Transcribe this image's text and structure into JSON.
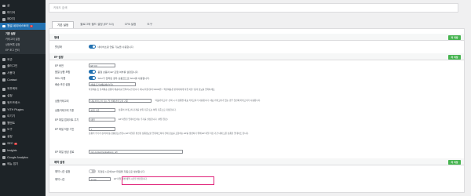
{
  "sidebar": {
    "items": [
      {
        "label": "글",
        "icon": "pin-icon"
      },
      {
        "label": "미디어",
        "icon": "media-icon"
      },
      {
        "label": "페이지",
        "icon": "page-icon"
      },
      {
        "label": "웹셀 네이버스토어",
        "icon": "store-icon",
        "badge": "1"
      }
    ],
    "submenu": [
      "기본 설정",
      "카테고리 설정",
      "상품목록 설정",
      "EP 포그 관리"
    ],
    "items2": [
      {
        "label": "외관",
        "icon": "brush-icon"
      },
      {
        "label": "플러그인",
        "icon": "plugin-icon"
      },
      {
        "label": "사용자",
        "icon": "user-icon"
      },
      {
        "label": "Contact",
        "icon": "mail-icon"
      },
      {
        "label": "외부케어",
        "icon": "tool-icon"
      },
      {
        "label": "설정",
        "icon": "gear-icon"
      },
      {
        "label": "워드프레스",
        "icon": "wp-icon"
      },
      {
        "label": "YITH Plugins",
        "icon": "yith-icon"
      },
      {
        "label": "이기기",
        "icon": "star-icon"
      },
      {
        "label": "웹앤트",
        "icon": "web-icon"
      },
      {
        "label": "도구",
        "icon": "wrench-icon"
      },
      {
        "label": "설정",
        "icon": "settings-icon"
      },
      {
        "label": "SEO",
        "icon": "seo-icon",
        "badge": "2"
      },
      {
        "label": "Insights",
        "icon": "insights-icon"
      },
      {
        "label": "Google Analytics",
        "icon": "analytics-icon"
      },
      {
        "label": "메뉴 접기",
        "icon": "collapse-icon"
      }
    ]
  },
  "topbar": {
    "placeholder": "키워드 검색"
  },
  "tabs": [
    "기본 설정",
    "블로그와 필드 설정 (EP 3.0)",
    "CPA 설정",
    "도구"
  ],
  "section1": {
    "title": "형태",
    "save": "저 저장",
    "rows": [
      {
        "label": "활성화",
        "text": "네이버쇼핑 연동 기능을 사용합니다."
      }
    ]
  },
  "section2": {
    "title": "EP 설정",
    "save": "저 저장",
    "rows": [
      {
        "label": "EP 버전",
        "field": "EP 3.0"
      },
      {
        "label": "품절 상품 포함",
        "text": "품절 상품의 EP 포함 여부를 설정합니다."
      },
      {
        "label": "SKU 사용",
        "text": "SKU가 입력된 경우 상품코드로 SKU를 사용합니다."
      },
      {
        "label": "배송 조건 설정",
        "field": "{배송조건}{배송비}{부가}",
        "note": "착불배송 및 설치배송 상품의 배송비를 입력하시면 됩니다. 예시)착불/설치 50000원 / \"착불배송은 판매자에게 직접 지불\" 등의 정보를 입력하세요."
      },
      {
        "label": "상품카테고리",
        "field": "대표카테고리 또는 첫 번째 카테고리 기준",
        "note": "\"대표카테고리\" 선택 시 각 상품별 대표 카테고리가 사용됩니다. 대표 카테고리가 없는 경우 첫번째 카테고리가 사용됩니다."
      },
      {
        "label": "상품카테고리 기준",
        "field": "하위 기준",
        "note": "상품의 카테고리 단계를 상위 기준 또는 하위 기준으로 지정합니다."
      },
      {
        "label": "EP 파일 업데이트 주기",
        "field": "매일",
        "note": "EP 파일을 업데이트하는 주기를 설정합니다. (매일 권장)"
      },
      {
        "label": "EP 파일 저장 기간",
        "field": "1",
        "note": "상품의 추가/수정/삭제 등 상품정보 변경시 EP 파일은 변경된 상품정보만 업데이트하며 전체 정보를 포함하는 EP를 생성하기 위해 EP 파일 저장 기간 내에 모든 상품을 업데이트 합니다."
      },
      {
        "label": "EP 파일 생성 경로",
        "field": "/wp-content/uploads/ep_url/"
      }
    ]
  },
  "section3": {
    "title": "예약 설정",
    "save": "저 저장",
    "rows": [
      {
        "label": "예약 시간 설정",
        "text": "지정된 시간에 EP 파일을 자동으로 생성합니다."
      },
      {
        "label": "예약 시간",
        "field": "17:00",
        "note": "EP 파일 생성 예약 시간을 설정합니다."
      }
    ]
  }
}
